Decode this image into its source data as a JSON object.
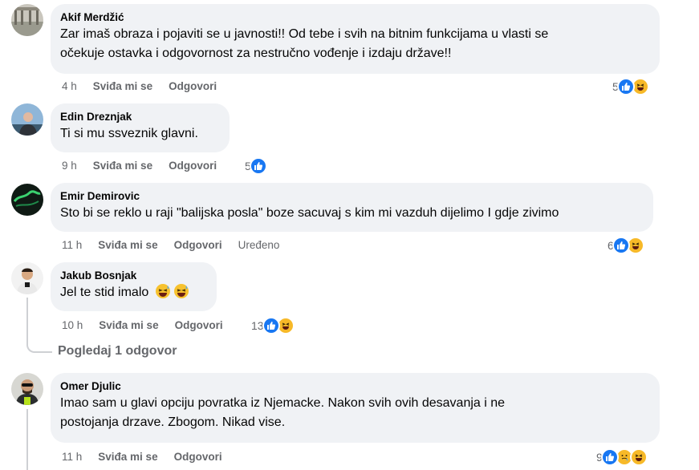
{
  "comments": [
    {
      "author": "Akif Merdžić",
      "text_lines": [
        "Zar imaš obraza i pojaviti se u javnosti!! Od tebe i svih na bitnim funkcijama u vlasti se",
        "očekuje ostavka i odgovornost za nestručno vođenje i izdaju države!!"
      ],
      "time": "4 h",
      "like_label": "Sviđa mi se",
      "reply_label": "Odgovori",
      "reaction_count": "5",
      "reactions": [
        "like-icon",
        "haha-icon"
      ]
    },
    {
      "author": "Edin Dreznjak",
      "text_lines": [
        "Ti si mu ssveznik glavni."
      ],
      "time": "9 h",
      "like_label": "Sviđa mi se",
      "reply_label": "Odgovori",
      "reaction_count": "5",
      "reactions": [
        "like-icon"
      ]
    },
    {
      "author": "Emir Demirovic",
      "text_lines": [
        "Sto bi se reklo u raji \"balijska posla\" boze sacuvaj s kim mi vazduh dijelimo I gdje zivimo"
      ],
      "time": "11 h",
      "like_label": "Sviđa mi se",
      "reply_label": "Odgovori",
      "edited_label": "Uređeno",
      "reaction_count": "6",
      "reactions": [
        "like-icon",
        "haha-icon"
      ]
    },
    {
      "author": "Jakub Bosnjak",
      "text_lines": [
        "Jel te stid imalo"
      ],
      "inline_emojis": [
        "grinning-sweat-emoji",
        "grinning-sweat-emoji"
      ],
      "time": "10 h",
      "like_label": "Sviđa mi se",
      "reply_label": "Odgovori",
      "reaction_count": "13",
      "reactions": [
        "like-icon",
        "haha-icon"
      ],
      "view_replies": "Pogledaj 1 odgovor"
    },
    {
      "author": "Omer Djulic",
      "text_lines": [
        "Imao sam u glavi opciju povratka iz Njemacke. Nakon svih ovih desavanja i ne",
        "postojanja drzave. Zbogom. Nikad vise."
      ],
      "time": "11 h",
      "like_label": "Sviđa mi se",
      "reply_label": "Odgovori",
      "reaction_count": "9",
      "reactions": [
        "like-icon",
        "care-icon",
        "haha-icon"
      ]
    }
  ],
  "colors": {
    "bubble": "#f0f2f5",
    "meta": "#65676b",
    "like": "#1877f2",
    "emoji": "#f7b928",
    "thread_line": "#ced0d4"
  }
}
